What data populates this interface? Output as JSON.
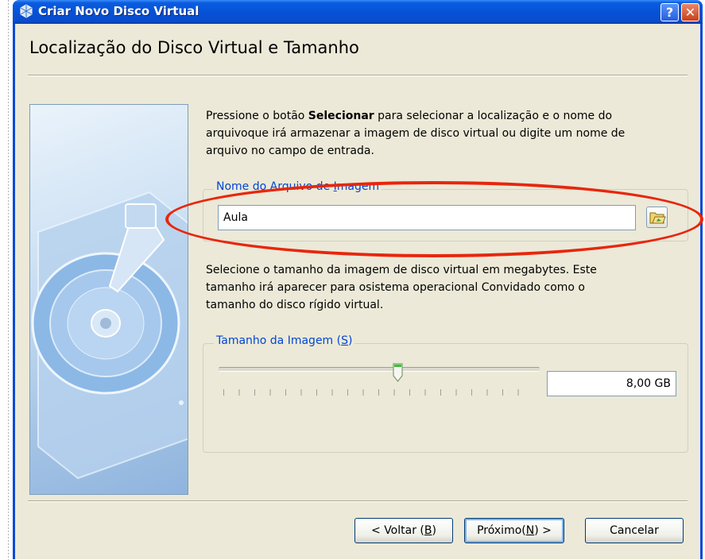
{
  "window": {
    "title": "Criar Novo Disco Virtual",
    "help_label": "?",
    "close_label": "✕"
  },
  "page": {
    "title": "Localização do Disco Virtual e Tamanho"
  },
  "intro": {
    "before": "Pressione o botão ",
    "bold": "Selecionar",
    "line1_after": " para selecionar a localização e o nome do",
    "line2": "arquivoque irá armazenar a imagem de disco virtual ou digite um nome de",
    "line3": "arquivo no campo de entrada."
  },
  "file_group": {
    "legend_before": "Nome do Arquivo de ",
    "legend_accel": "I",
    "legend_after": "magem",
    "value": "Aula"
  },
  "size_text": {
    "line1": "Selecione o tamanho da imagem de disco virtual em megabytes. Este",
    "line2": "tamanho irá aparecer para osistema operacional Convidado como o",
    "line3": "tamanho do disco rígido virtual."
  },
  "size_group": {
    "legend_before": "Tamanho da Imagem (",
    "legend_accel": "S",
    "legend_after": ")",
    "value": "8,00 GB",
    "slider_fraction": 0.55
  },
  "buttons": {
    "back": {
      "before": "< Voltar (",
      "accel": "B",
      "after": ")"
    },
    "next": {
      "before": "Próximo(",
      "accel": "N",
      "after": ") >"
    },
    "cancel": "Cancelar"
  },
  "colors": {
    "titlebar": "#0652d8",
    "dialog_bg": "#ece9d8",
    "legend": "#0046d5",
    "annotation": "#e8260c"
  },
  "icons": [
    "virtualbox-icon",
    "help-icon",
    "close-icon",
    "folder-browse-icon",
    "hard-disk-illustration",
    "slider-thumb-icon"
  ]
}
